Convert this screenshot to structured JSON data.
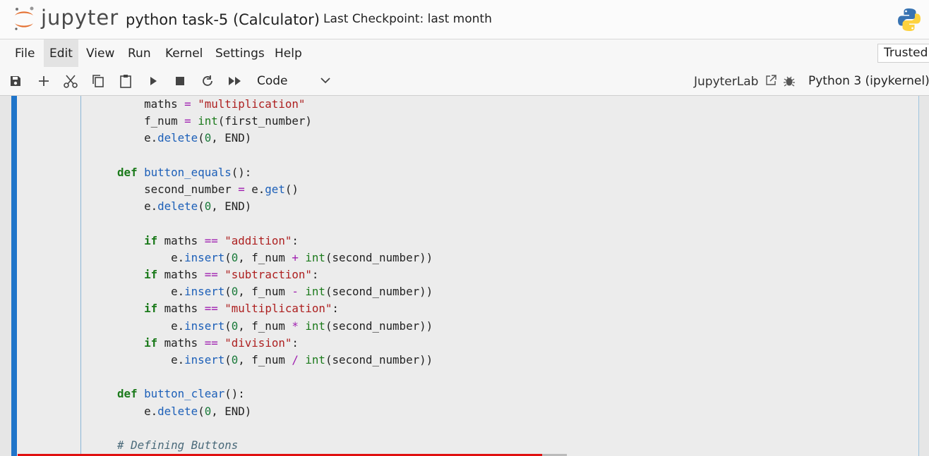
{
  "app": {
    "logo_text": "jupyter",
    "notebook_title": "python task-5 (Calculator)",
    "checkpoint": "Last Checkpoint: last month"
  },
  "menu": [
    {
      "label": "File"
    },
    {
      "label": "Edit"
    },
    {
      "label": "View"
    },
    {
      "label": "Run"
    },
    {
      "label": "Kernel"
    },
    {
      "label": "Settings"
    },
    {
      "label": "Help"
    }
  ],
  "trusted": "Trusted",
  "toolbar": {
    "icons": [
      "save-icon",
      "add-cell-icon",
      "cut-icon",
      "copy-icon",
      "paste-icon",
      "run-icon",
      "stop-icon",
      "restart-icon",
      "fast-forward-icon"
    ],
    "cell_type": "Code",
    "jupyterlab_label": "JupyterLab",
    "kernel_name": "Python 3 (ipykernel)"
  },
  "code_lines": [
    "        maths = \"multiplication\"",
    "        f_num = int(first_number)",
    "        e.delete(0, END)",
    "",
    "    def button_equals():",
    "        second_number = e.get()",
    "        e.delete(0, END)",
    "",
    "        if maths == \"addition\":",
    "            e.insert(0, f_num + int(second_number))",
    "        if maths == \"subtraction\":",
    "            e.insert(0, f_num - int(second_number))",
    "        if maths == \"multiplication\":",
    "            e.insert(0, f_num * int(second_number))",
    "        if maths == \"division\":",
    "            e.insert(0, f_num / int(second_number))",
    "",
    "    def button_clear():",
    "        e.delete(0, END)",
    "",
    "    # Defining Buttons"
  ],
  "video_progress": 0.565,
  "colors": {
    "accent": "#1f74c9",
    "progress": "#e01010",
    "keyword": "#1b7a1b",
    "string": "#ad1f1f",
    "method": "#1c5fb8",
    "operator": "#a020b0"
  }
}
